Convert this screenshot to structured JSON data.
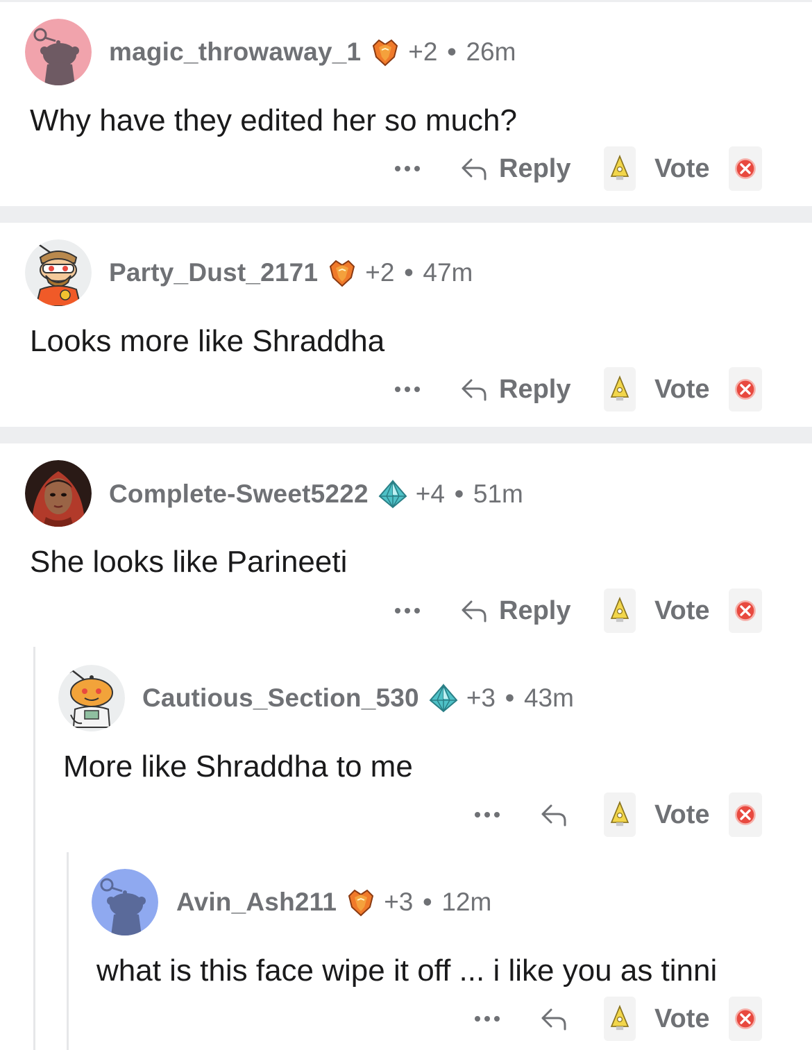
{
  "comments": [
    {
      "username": "magic_throwaway_1",
      "flair_icon": "red-crystal-award-icon",
      "karma": "+2",
      "separator": "•",
      "age": "26m",
      "body": "Why have they edited her so much?",
      "reply_label": "Reply",
      "vote_label": "Vote"
    },
    {
      "username": "Party_Dust_2171",
      "flair_icon": "red-crystal-award-icon",
      "karma": "+2",
      "separator": "•",
      "age": "47m",
      "body": "Looks more like Shraddha",
      "reply_label": "Reply",
      "vote_label": "Vote"
    },
    {
      "username": "Complete-Sweet5222",
      "flair_icon": "teal-diamond-award-icon",
      "karma": "+4",
      "separator": "•",
      "age": "51m",
      "body": "She looks like Parineeti",
      "reply_label": "Reply",
      "vote_label": "Vote"
    },
    {
      "username": "Cautious_Section_530",
      "flair_icon": "teal-diamond-award-icon",
      "karma": "+3",
      "separator": "•",
      "age": "43m",
      "body": "More like Shraddha to me",
      "vote_label": "Vote"
    },
    {
      "username": "Avin_Ash211",
      "flair_icon": "red-crystal-award-icon",
      "karma": "+3",
      "separator": "•",
      "age": "12m",
      "body": "what is this face wipe it off ... i like you as tinni",
      "vote_label": "Vote"
    }
  ],
  "colors": {
    "meta_text": "#6f7175",
    "body_text": "#1a1a1b",
    "separator": "#edeef0",
    "avatar_pink": "#f1a3ac",
    "avatar_blue": "#8fa9f0",
    "downvote_red": "#e8493f",
    "upvote_yellow": "#f2d64b"
  }
}
